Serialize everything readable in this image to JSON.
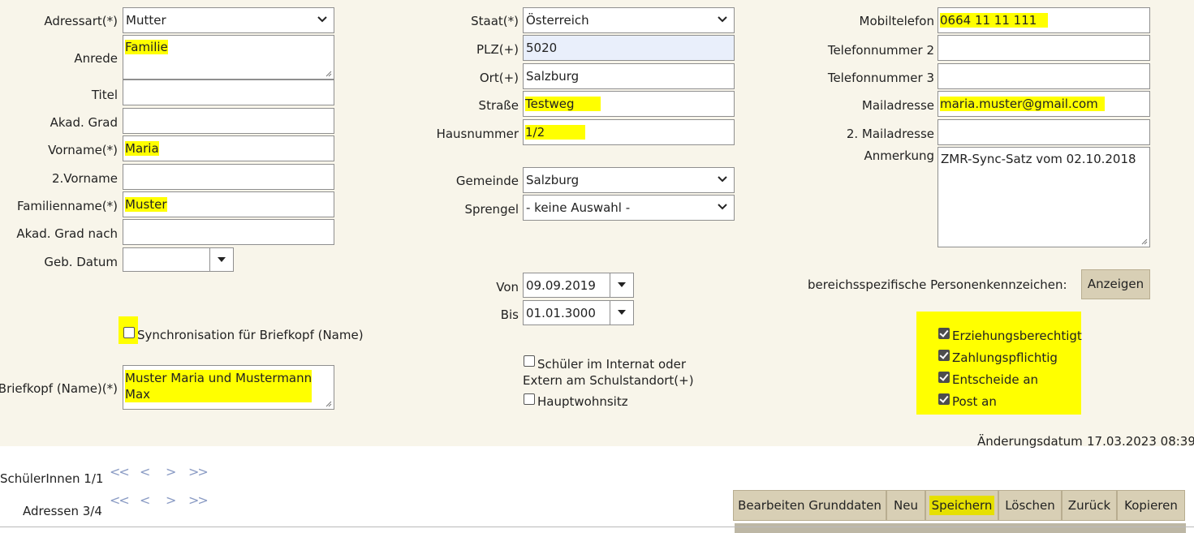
{
  "left": {
    "adressart_label": "Adressart(*)",
    "adressart_value": "Mutter",
    "anrede_label": "Anrede",
    "anrede_value": "Familie",
    "titel_label": "Titel",
    "titel_value": "",
    "akad_grad_label": "Akad. Grad",
    "akad_grad_value": "",
    "vorname_label": "Vorname(*)",
    "vorname_value": "Maria",
    "zweiter_vorname_label": "2.Vorname",
    "zweiter_vorname_value": "",
    "familienname_label": "Familienname(*)",
    "familienname_value": "Muster",
    "akad_grad_nach_label": "Akad. Grad nach",
    "akad_grad_nach_value": "",
    "geb_datum_label": "Geb. Datum",
    "geb_datum_value": "",
    "sync_label": "Synchronisation für Briefkopf (Name)",
    "sync_checked": false,
    "briefkopf_label": "Briefkopf (Name)(*)",
    "briefkopf_value_line1": "Muster Maria und Mustermann",
    "briefkopf_value_line2": "Max"
  },
  "middle": {
    "staat_label": "Staat(*)",
    "staat_value": "Österreich",
    "plz_label": "PLZ(+)",
    "plz_value": "5020",
    "ort_label": "Ort(+)",
    "ort_value": "Salzburg",
    "strasse_label": "Straße",
    "strasse_value": "Testweg",
    "hausnummer_label": "Hausnummer",
    "hausnummer_value": "1/2",
    "gemeinde_label": "Gemeinde",
    "gemeinde_value": "Salzburg",
    "sprengel_label": "Sprengel",
    "sprengel_value": "- keine Auswahl -",
    "von_label": "Von",
    "von_value": "09.09.2019",
    "bis_label": "Bis",
    "bis_value": "01.01.3000",
    "internat_label_line1": "Schüler im Internat oder",
    "internat_label_line2": "Extern am Schulstandort(+)",
    "internat_checked": false,
    "hauptwohnsitz_label": "Hauptwohnsitz",
    "hauptwohnsitz_checked": false
  },
  "right": {
    "mobiltelefon_label": "Mobiltelefon",
    "mobiltelefon_value": "0664 11 11 111",
    "telefon2_label": "Telefonnummer 2",
    "telefon2_value": "",
    "telefon3_label": "Telefonnummer 3",
    "telefon3_value": "",
    "mail_label": "Mailadresse",
    "mail_value": "maria.muster@gmail.com",
    "mail2_label": "2. Mailadresse",
    "mail2_value": "",
    "anmerkung_label": "Anmerkung",
    "anmerkung_value": "ZMR-Sync-Satz vom 02.10.2018",
    "bpk_label": "bereichsspezifische Personenkennzeichen:",
    "anzeigen_button": "Anzeigen",
    "checkboxes": [
      {
        "label": "Erziehungsberechtigt",
        "checked": true
      },
      {
        "label": "Zahlungspflichtig",
        "checked": true
      },
      {
        "label": "Entscheide an",
        "checked": true
      },
      {
        "label": "Post an",
        "checked": true
      }
    ],
    "aenderungsdatum_label": "Änderungsdatum",
    "aenderungsdatum_value": "17.03.2023 08:39"
  },
  "footer": {
    "schueler_label": "SchülerInnen 1/1",
    "adressen_label": "Adressen 3/4",
    "nav_first": "<<",
    "nav_prev": "<",
    "nav_next": ">",
    "nav_last": ">>",
    "buttons": {
      "bearbeiten": "Bearbeiten Grunddaten",
      "neu": "Neu",
      "speichern": "Speichern",
      "loeschen": "Löschen",
      "zurueck": "Zurück",
      "kopieren": "Kopieren"
    }
  },
  "colors": {
    "panel_bg": "#f8f5ea",
    "highlight": "#ffff00",
    "button_bg": "#d8cfb5",
    "nav_arrows": "#8a9bc4"
  }
}
